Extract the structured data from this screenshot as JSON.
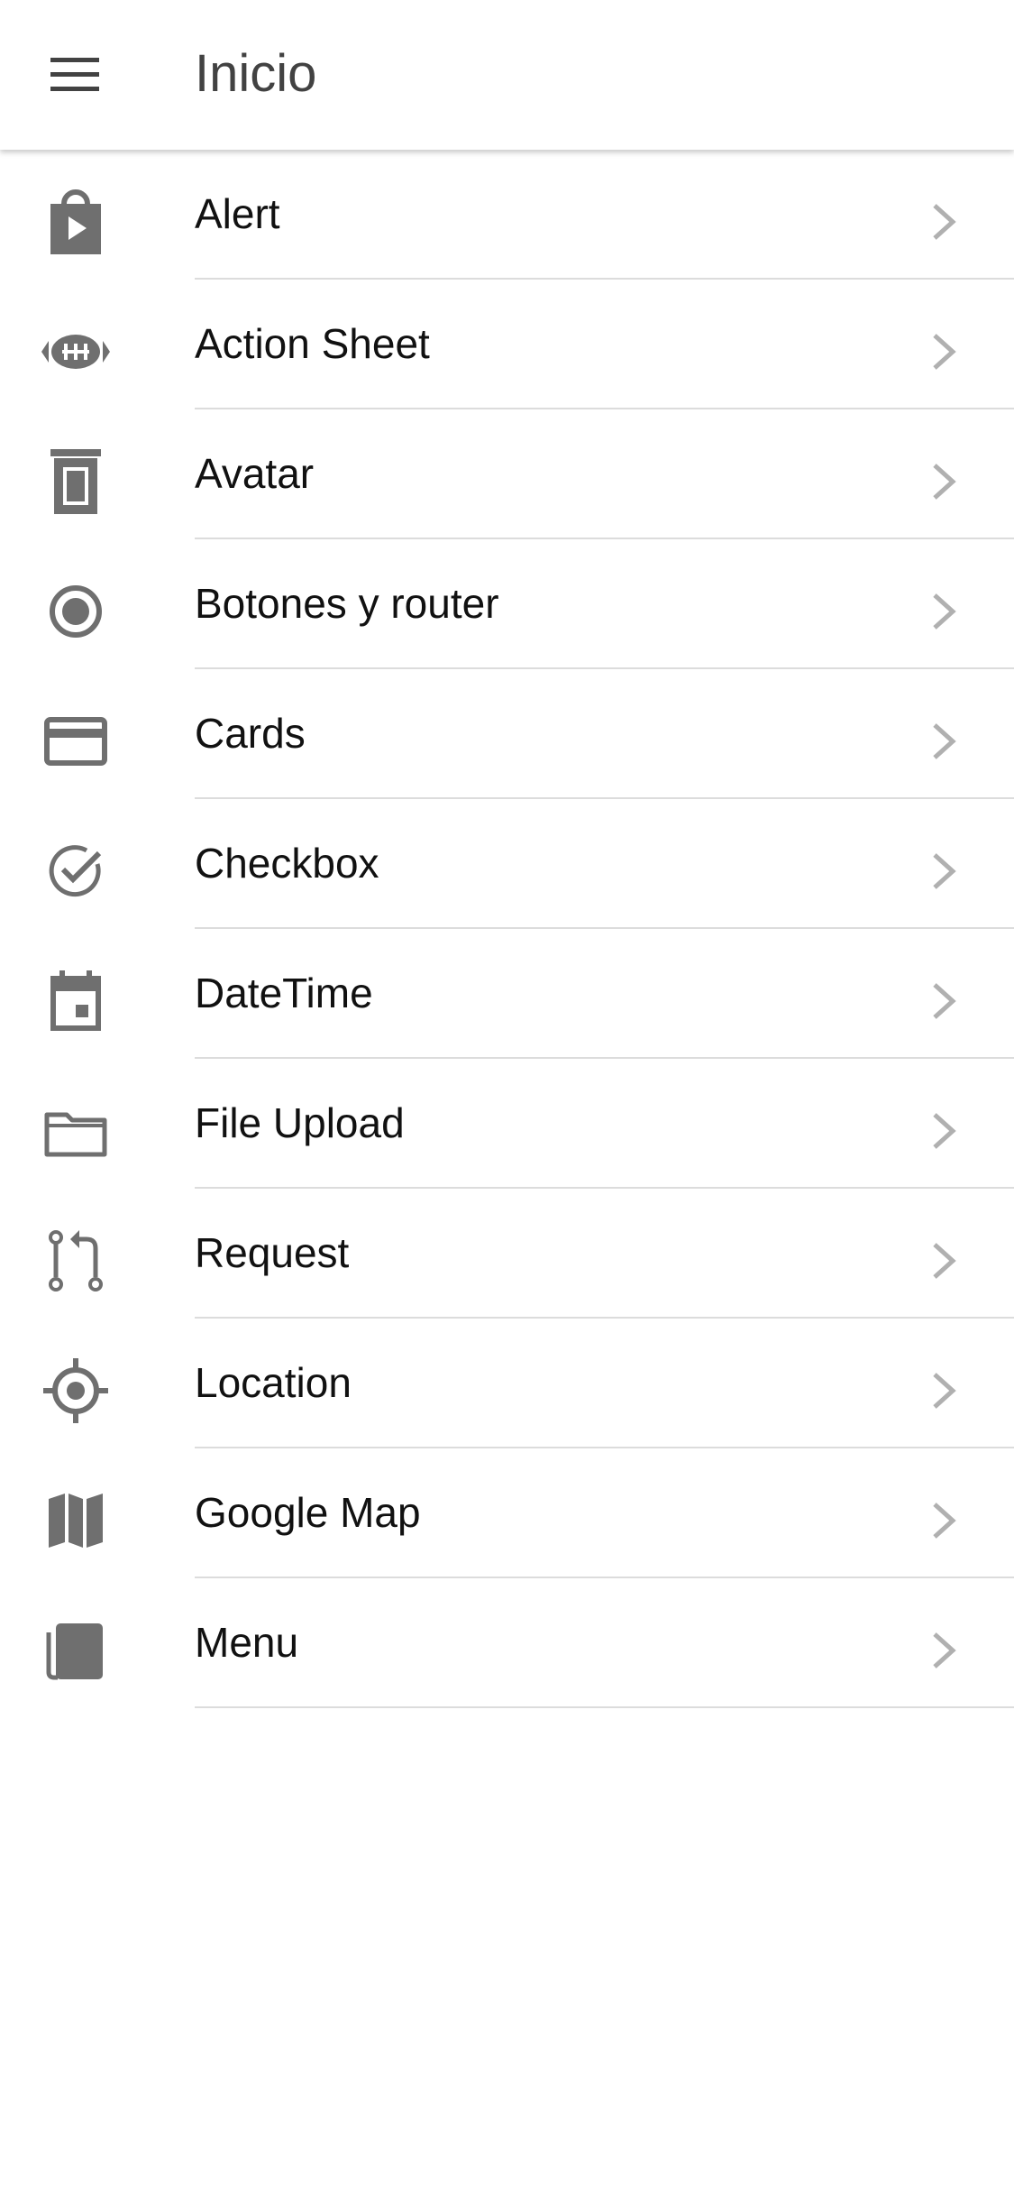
{
  "header": {
    "title": "Inicio",
    "menu_icon": "hamburger-menu-icon"
  },
  "colors": {
    "icon": "#6f6f6f",
    "chevron": "#b0b0b0",
    "divider": "#dcdcdc",
    "text": "#111111",
    "title": "#424242"
  },
  "items": [
    {
      "label": "Alert",
      "icon": "shopping-bag-play-icon"
    },
    {
      "label": "Action Sheet",
      "icon": "football-icon"
    },
    {
      "label": "Avatar",
      "icon": "delete-bin-icon"
    },
    {
      "label": "Botones y router",
      "icon": "radio-button-icon"
    },
    {
      "label": "Cards",
      "icon": "credit-card-icon"
    },
    {
      "label": "Checkbox",
      "icon": "check-circle-icon"
    },
    {
      "label": "DateTime",
      "icon": "calendar-icon"
    },
    {
      "label": "File Upload",
      "icon": "folder-icon"
    },
    {
      "label": "Request",
      "icon": "git-pull-request-icon"
    },
    {
      "label": "Location",
      "icon": "locate-icon"
    },
    {
      "label": "Google Map",
      "icon": "map-icon"
    },
    {
      "label": "Menu",
      "icon": "copy-icon"
    }
  ]
}
